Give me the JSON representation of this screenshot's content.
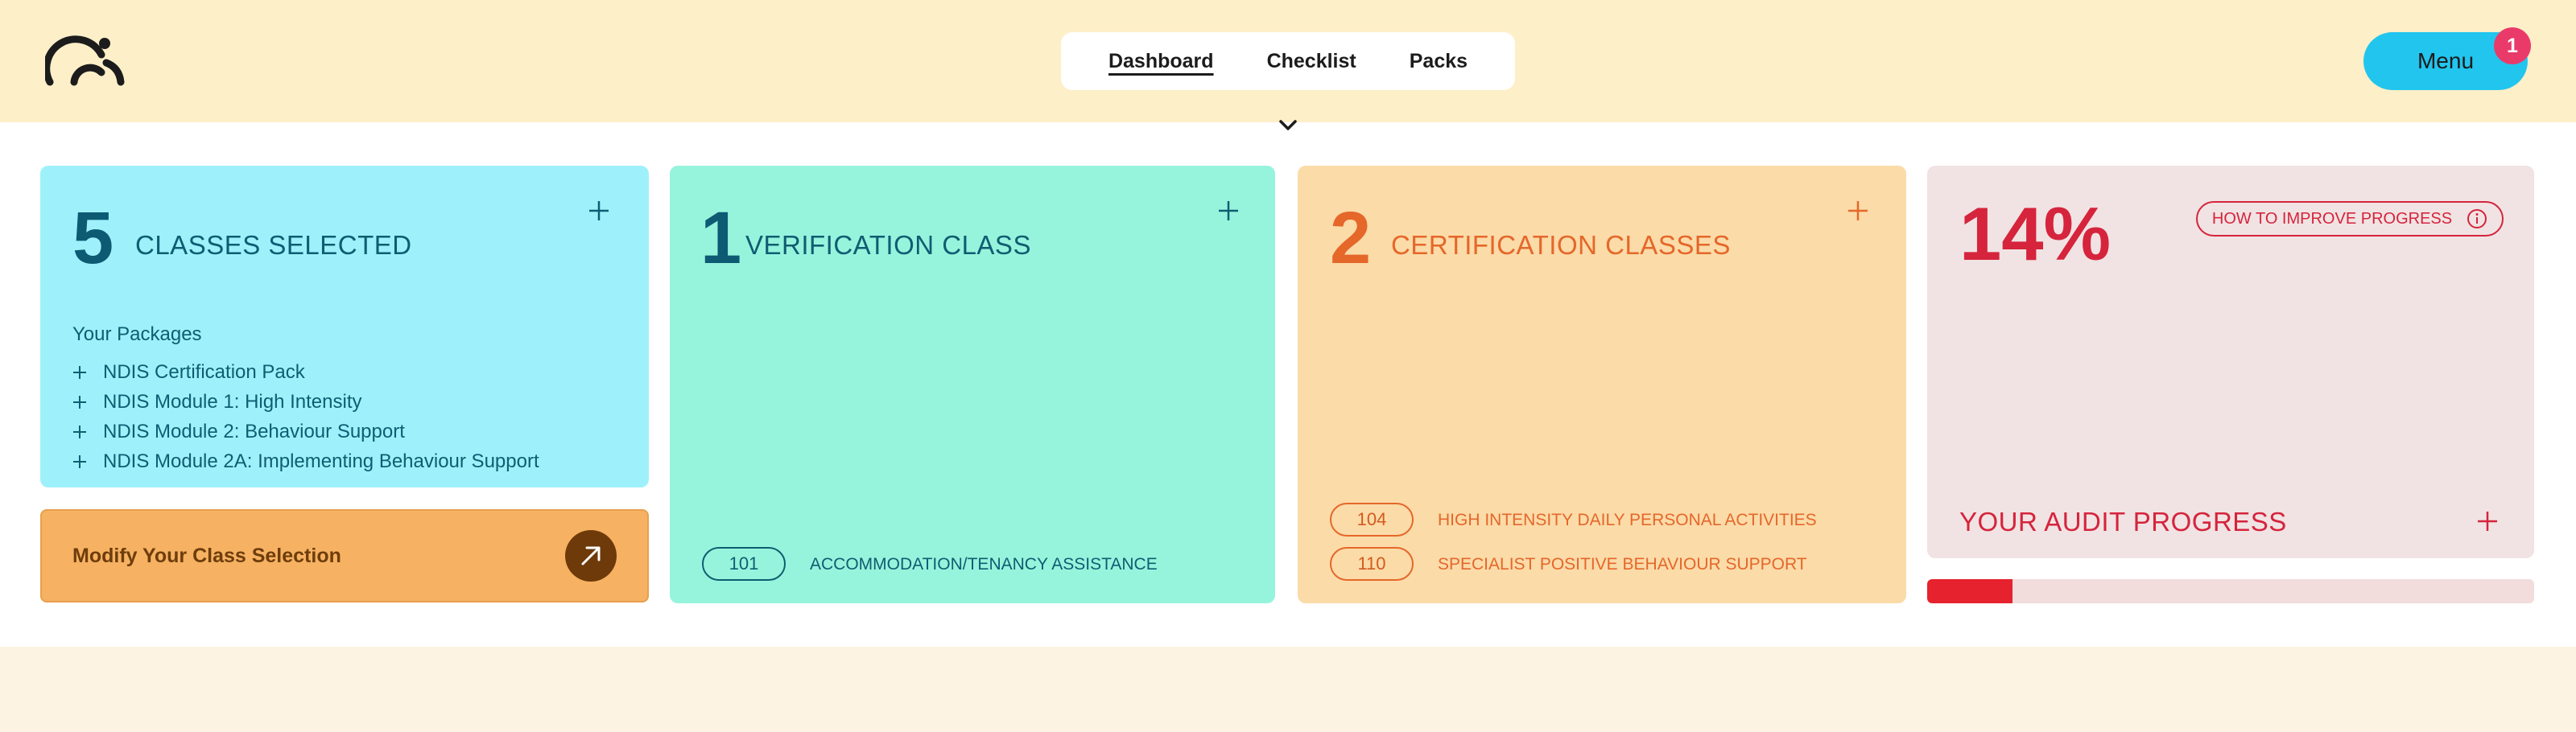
{
  "header": {
    "nav": [
      "Dashboard",
      "Checklist",
      "Packs"
    ],
    "active_nav": "Dashboard",
    "menu_label": "Menu",
    "menu_badge": "1"
  },
  "cards": {
    "classes_selected": {
      "number": "5",
      "title": "CLASSES SELECTED",
      "packages_heading": "Your Packages",
      "packages": [
        "NDIS Certification Pack",
        "NDIS Module 1: High Intensity",
        "NDIS Module 2: Behaviour Support",
        "NDIS Module 2A: Implementing Behaviour Support"
      ]
    },
    "modify_label": "Modify Your Class Selection",
    "verification": {
      "number": "1",
      "title": "VERIFICATION CLASS",
      "items": [
        {
          "code": "101",
          "label": "ACCOMMODATION/TENANCY ASSISTANCE"
        }
      ]
    },
    "certification": {
      "number": "2",
      "title": "CERTIFICATION CLASSES",
      "items": [
        {
          "code": "104",
          "label": "HIGH INTENSITY DAILY PERSONAL ACTIVITIES"
        },
        {
          "code": "110",
          "label": "SPECIALIST POSITIVE BEHAVIOUR SUPPORT"
        }
      ]
    },
    "audit": {
      "percent": "14%",
      "progress": 0.14,
      "improve_label": "HOW TO IMPROVE PROGRESS",
      "title": "YOUR AUDIT PROGRESS"
    }
  },
  "colors": {
    "header_bg": "#fdefc8",
    "menu_blue": "#22c5ee",
    "badge_pink": "#ea3a6a",
    "card_blue": "#9ef1fb",
    "card_green": "#97f4dc",
    "card_orange": "#fbdba8",
    "card_pink": "#f1e3e3",
    "modify_orange": "#f6b262",
    "progress_red": "#e6222e"
  },
  "icons": [
    "logo-icon",
    "chevron-down-icon",
    "plus-icon",
    "arrow-up-right-icon",
    "info-icon"
  ]
}
